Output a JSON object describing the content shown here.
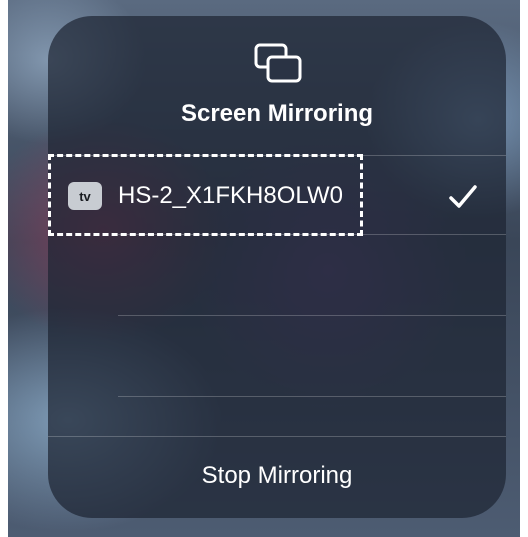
{
  "panel": {
    "title": "Screen Mirroring",
    "header_icon": "screen-mirroring-icon"
  },
  "devices": [
    {
      "icon": "apple-tv-icon",
      "icon_text": "tv",
      "name": "HS-2_X1FKH8OLW0",
      "selected": true,
      "selected_icon": "checkmark-icon"
    }
  ],
  "actions": {
    "stop_label": "Stop Mirroring"
  }
}
